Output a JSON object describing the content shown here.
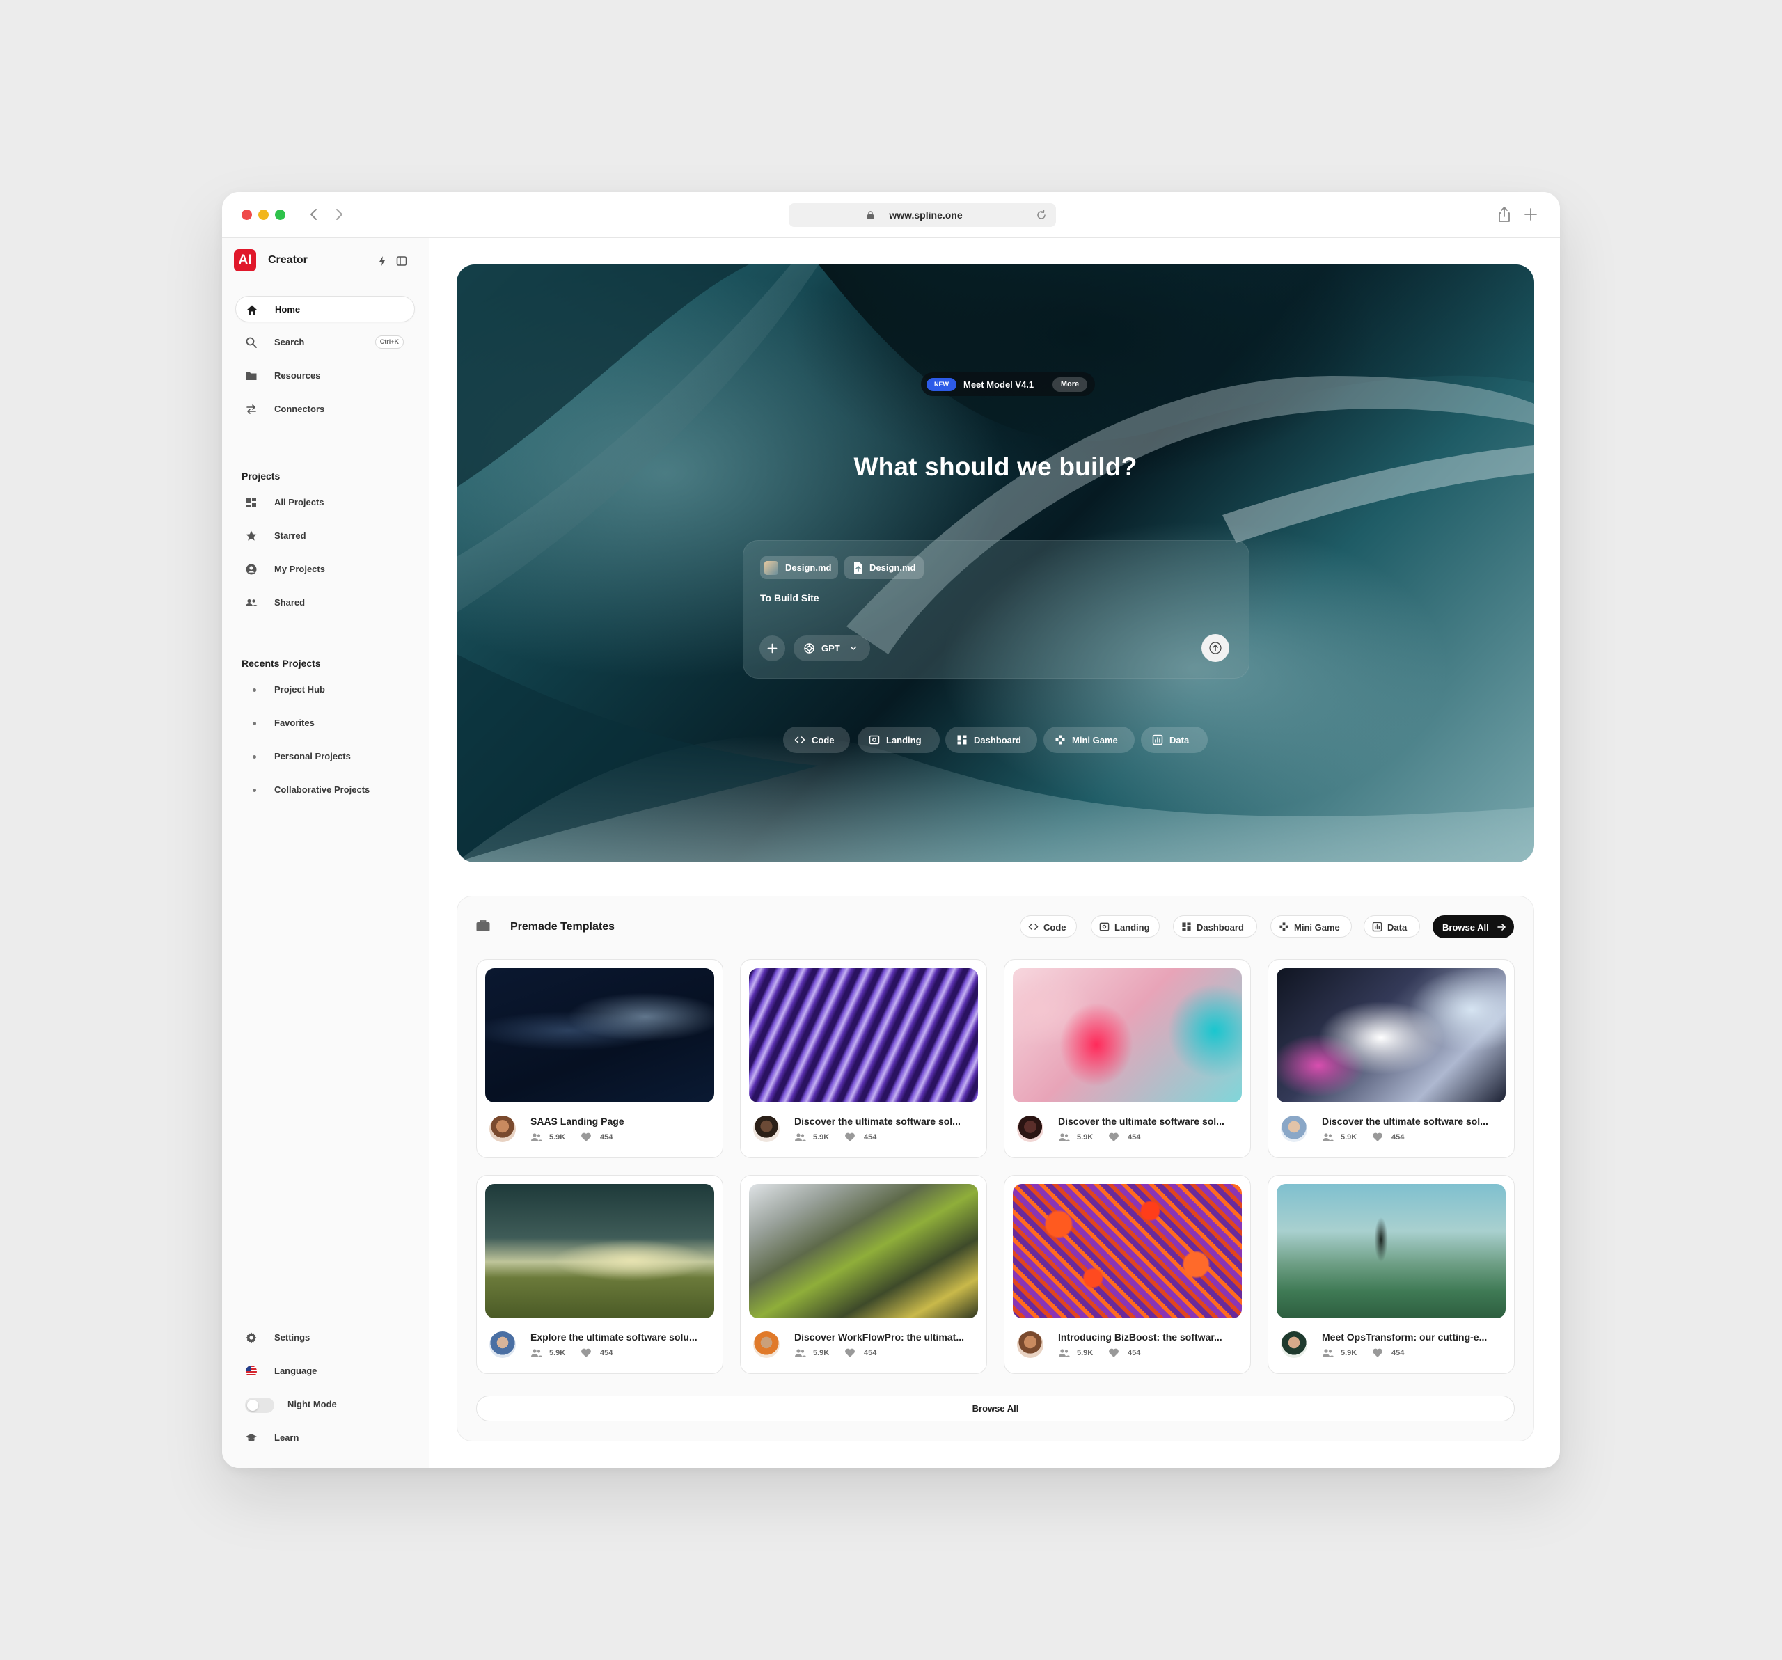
{
  "browser": {
    "url": "www.spline.one"
  },
  "sidebar": {
    "brand": {
      "logo_text": "AI",
      "name": "Creator"
    },
    "nav": [
      {
        "label": "Home",
        "icon": "home-icon"
      },
      {
        "label": "Search",
        "icon": "search-icon",
        "shortcut": "Ctrl+K"
      },
      {
        "label": "Resources",
        "icon": "folder-icon"
      },
      {
        "label": "Connectors",
        "icon": "arrows-swap-icon"
      }
    ],
    "projects_title": "Projects",
    "projects": [
      {
        "label": "All Projects",
        "icon": "grid-icon"
      },
      {
        "label": "Starred",
        "icon": "star-icon"
      },
      {
        "label": "My Projects",
        "icon": "user-circle-icon"
      },
      {
        "label": "Shared",
        "icon": "people-icon"
      }
    ],
    "recents_title": "Recents Projects",
    "recents": [
      {
        "label": "Project Hub"
      },
      {
        "label": "Favorites"
      },
      {
        "label": "Personal Projects"
      },
      {
        "label": "Collaborative Projects"
      }
    ],
    "bottom": {
      "settings": "Settings",
      "language": "Language",
      "night_mode": "Night Mode",
      "night_mode_on": false,
      "learn": "Learn"
    }
  },
  "hero": {
    "badge_new": "NEW",
    "badge_text": "Meet Model V4.1",
    "badge_more": "More",
    "title": "What should we build?",
    "attachments": [
      "Design.md",
      "Design.md"
    ],
    "prompt_text": "To Build Site",
    "model": "GPT",
    "pills": [
      {
        "label": "Code",
        "icon": "code-icon"
      },
      {
        "label": "Landing",
        "icon": "landing-icon"
      },
      {
        "label": "Dashboard",
        "icon": "dashboard-icon"
      },
      {
        "label": "Mini Game",
        "icon": "gamepad-icon"
      },
      {
        "label": "Data",
        "icon": "chart-icon"
      }
    ]
  },
  "templates": {
    "title": "Premade Templates",
    "filters": [
      {
        "label": "Code",
        "icon": "code-icon"
      },
      {
        "label": "Landing",
        "icon": "landing-icon"
      },
      {
        "label": "Dashboard",
        "icon": "dashboard-icon"
      },
      {
        "label": "Mini Game",
        "icon": "gamepad-icon"
      },
      {
        "label": "Data",
        "icon": "chart-icon"
      }
    ],
    "browse_all_button": "Browse All",
    "cards": [
      {
        "title": "SAAS Landing Page",
        "users": "5.9K",
        "likes": "454"
      },
      {
        "title": "Discover the ultimate software sol...",
        "users": "5.9K",
        "likes": "454"
      },
      {
        "title": "Discover the ultimate software sol...",
        "users": "5.9K",
        "likes": "454"
      },
      {
        "title": "Discover the ultimate software sol...",
        "users": "5.9K",
        "likes": "454"
      },
      {
        "title": "Explore the ultimate software solu...",
        "users": "5.9K",
        "likes": "454"
      },
      {
        "title": "Discover WorkFlowPro: the ultimat...",
        "users": "5.9K",
        "likes": "454"
      },
      {
        "title": "Introducing BizBoost: the softwar...",
        "users": "5.9K",
        "likes": "454"
      },
      {
        "title": "Meet OpsTransform: our cutting-e...",
        "users": "5.9K",
        "likes": "454"
      }
    ],
    "browse_all_footer": "Browse All"
  }
}
